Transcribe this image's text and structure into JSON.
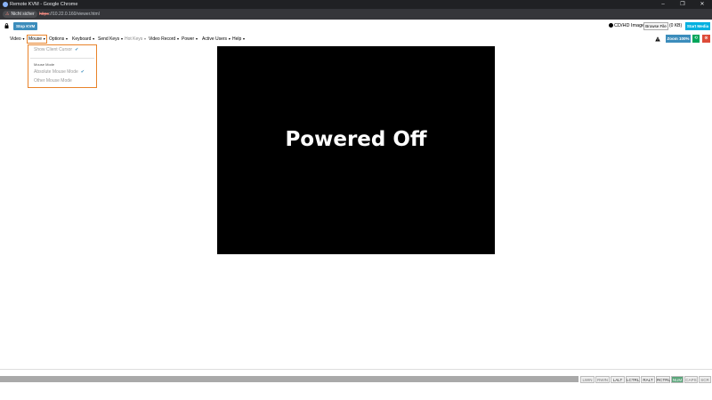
{
  "browser": {
    "title": "Remote KVM - Google Chrome",
    "minimize_glyph": "–",
    "maximize_glyph": "❐",
    "close_glyph": "✕",
    "security_text": "Nicht sicher",
    "security_glyph": "⚠",
    "url_scheme": "https",
    "url_rest": "://10.22.0.160/viewer.html"
  },
  "toolbar": {
    "stop_kvm_label": "Stop KVM",
    "cd_label": "CD/HD Image:",
    "browse_label": "Browse File",
    "file_size": "(0 KB)",
    "start_media_label": "Start Media"
  },
  "menubar": {
    "items": [
      {
        "label": "Video",
        "caret": "▼"
      },
      {
        "label": "Mouse",
        "caret": "▼"
      },
      {
        "label": "Options",
        "caret": "▼"
      },
      {
        "label": "Keyboard",
        "caret": "▼"
      },
      {
        "label": "Send Keys",
        "caret": "▼"
      },
      {
        "label": "Hot Keys",
        "caret": "▼"
      },
      {
        "label": "Video Record",
        "caret": "▼"
      },
      {
        "label": "Power",
        "caret": "▼"
      },
      {
        "label": "Active Users",
        "caret": "▼"
      },
      {
        "label": "Help",
        "caret": "▼"
      }
    ],
    "zoom_label": "Zoom 100%",
    "fullscreen_glyph": "⟲",
    "close_glyph": "⊗"
  },
  "mouse_menu": {
    "show_cursor": "Show Client Cursor",
    "check_glyph": "✔",
    "section_header": "Mouse Mode",
    "absolute": "Absolute Mouse Mode",
    "other": "Other Mouse Mode"
  },
  "viewer": {
    "message": "Powered Off"
  },
  "statusbar": {
    "keys": [
      {
        "label": "LWIN",
        "on": false
      },
      {
        "label": "RWIN",
        "on": false
      },
      {
        "label": "LALT",
        "on": false
      },
      {
        "label": "LCTRL",
        "on": false
      },
      {
        "label": "RALT",
        "on": false
      },
      {
        "label": "RCTRL",
        "on": false
      },
      {
        "label": "NUM",
        "on": true
      },
      {
        "label": "CAPS",
        "on": false
      },
      {
        "label": "SCR",
        "on": false
      }
    ]
  },
  "colors": {
    "primary": "#3c8dbc",
    "media": "#00b0e0",
    "success": "#00a65a",
    "danger": "#dd4b39",
    "menu_highlight": "#e8832a"
  }
}
